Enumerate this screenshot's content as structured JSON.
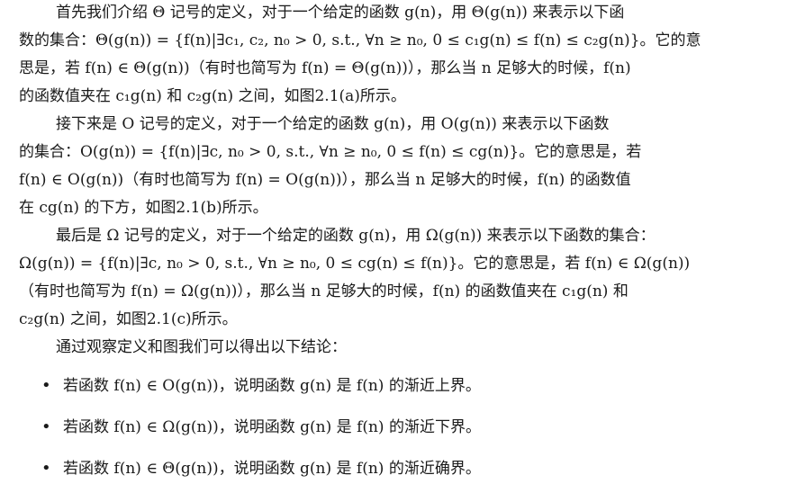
{
  "paragraph_theta": {
    "lines": [
      "首先我们介绍 Θ 记号的定义，对于一个给定的函数 g(n)，用 Θ(g(n)) 来表示以下函",
      "数的集合：Θ(g(n)) = {f(n)|∃c₁, c₂, n₀ > 0, s.t., ∀n ≥ n₀, 0 ≤ c₁g(n) ≤ f(n) ≤ c₂g(n)}。它的意",
      "思是，若 f(n) ∈ Θ(g(n))（有时也简写为 f(n) = Θ(g(n))），那么当 n 足够大的时候，f(n)",
      "的函数值夹在 c₁g(n) 和 c₂g(n) 之间，如图2.1(a)所示。"
    ]
  },
  "paragraph_o": {
    "lines": [
      "接下来是 O 记号的定义，对于一个给定的函数 g(n)，用 O(g(n)) 来表示以下函数",
      "的集合：O(g(n)) = {f(n)|∃c, n₀ > 0, s.t., ∀n ≥ n₀, 0 ≤ f(n) ≤ cg(n)}。它的意思是，若",
      "f(n) ∈ O(g(n))（有时也简写为 f(n) = O(g(n))），那么当 n 足够大的时候，f(n) 的函数值",
      "在 cg(n) 的下方，如图2.1(b)所示。"
    ]
  },
  "paragraph_omega": {
    "lines": [
      "最后是 Ω 记号的定义，对于一个给定的函数 g(n)，用 Ω(g(n)) 来表示以下函数的集合：",
      "Ω(g(n)) = {f(n)|∃c, n₀ > 0, s.t., ∀n ≥ n₀, 0 ≤ cg(n) ≤ f(n)}。它的意思是，若 f(n) ∈ Ω(g(n))",
      "（有时也简写为 f(n) = Ω(g(n))），那么当 n 足够大的时候，f(n) 的函数值夹在 c₁g(n) 和",
      "c₂g(n) 之间，如图2.1(c)所示。"
    ]
  },
  "conclusion_intro": "通过观察定义和图我们可以得出以下结论：",
  "bullets": [
    "若函数 f(n) ∈ O(g(n))，说明函数 g(n) 是 f(n) 的渐近上界。",
    "若函数 f(n) ∈ Ω(g(n))，说明函数 g(n) 是 f(n) 的渐近下界。",
    "若函数 f(n) ∈ Θ(g(n))，说明函数 g(n) 是 f(n) 的渐近确界。"
  ],
  "bullet_symbol": "•"
}
